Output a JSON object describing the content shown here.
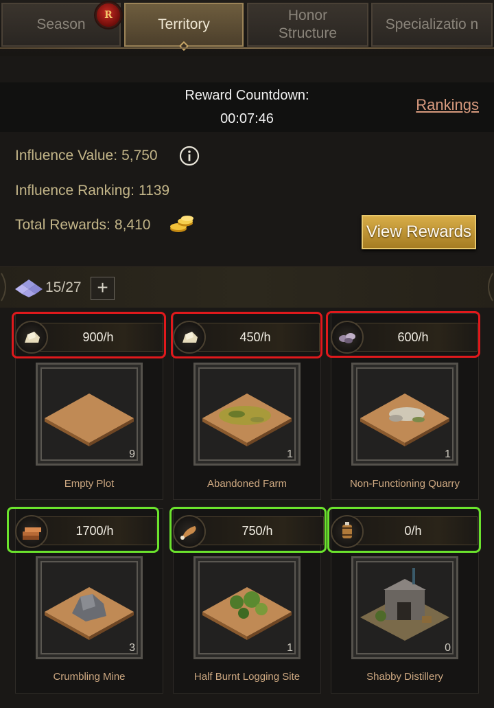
{
  "tabs": [
    {
      "label": "Season"
    },
    {
      "label": "Territory"
    },
    {
      "label": "Honor Structure"
    },
    {
      "label": "Specializatio n"
    }
  ],
  "season_badge": "R",
  "countdown": {
    "title": "Reward Countdown:",
    "time": "00:07:46"
  },
  "rankings_link": "Rankings",
  "stats": {
    "influence_value_label": "Influence Value:",
    "influence_value": "5,750",
    "influence_ranking_label": "Influence Ranking:",
    "influence_ranking": "1139",
    "total_rewards_label": "Total Rewards:",
    "total_rewards": "8,410"
  },
  "view_rewards_label": "View Rewards",
  "plots": {
    "count": "15/27",
    "plus": "+"
  },
  "cards": [
    {
      "rate": "900/h",
      "name": "Empty Plot",
      "count": "9",
      "resource": "stone-icon",
      "highlight": "red"
    },
    {
      "rate": "450/h",
      "name": "Abandoned Farm",
      "count": "1",
      "resource": "stone-icon",
      "highlight": "red"
    },
    {
      "rate": "600/h",
      "name": "Non-Functioning Quarry",
      "count": "1",
      "resource": "ore-icon",
      "highlight": "red"
    },
    {
      "rate": "1700/h",
      "name": "Crumbling Mine",
      "count": "3",
      "resource": "wood-icon",
      "highlight": "green"
    },
    {
      "rate": "750/h",
      "name": "Half Burnt Logging Site",
      "count": "1",
      "resource": "meat-icon",
      "highlight": "green"
    },
    {
      "rate": "0/h",
      "name": "Shabby Distillery",
      "count": "0",
      "resource": "barrel-icon",
      "highlight": "green"
    }
  ],
  "colors": {
    "red_highlight": "#e0191c",
    "green_highlight": "#6be32d",
    "gold_button": "#c8982f"
  }
}
